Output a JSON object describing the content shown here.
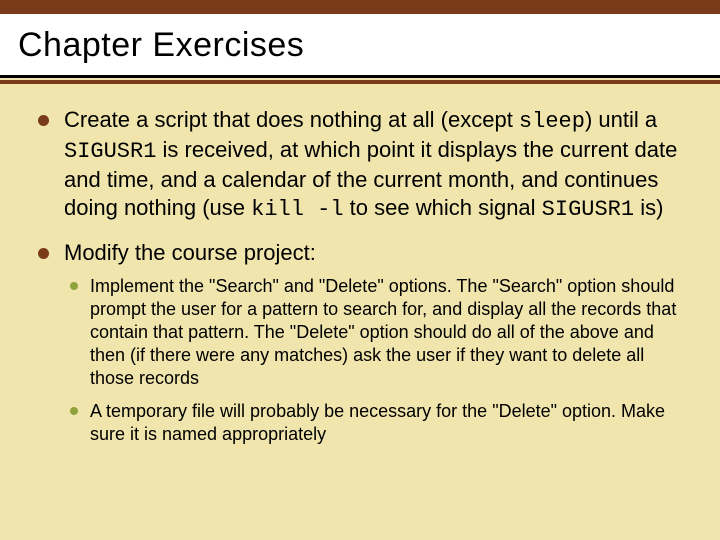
{
  "title": "Chapter Exercises",
  "bullets": {
    "item1": {
      "t1": "Create a script that does nothing at all (except ",
      "c1": "sleep",
      "t2": ") until a ",
      "c2": "SIGUSR1",
      "t3": " is received, at which point it displays the current date and time, and a calendar of the current month, and continues doing nothing (use ",
      "c3": "kill -l",
      "t4": " to see which signal ",
      "c4": "SIGUSR1",
      "t5": " is)"
    },
    "item2": {
      "t1": "Modify the course project:",
      "sub1": "Implement the \"Search\" and \"Delete\" options.  The \"Search\" option should prompt the user for a pattern to search for, and display all the records that contain that pattern.  The \"Delete\" option should do all of the above and then (if there were any matches) ask the user if they want to delete all those records",
      "sub2": "A temporary file will probably be necessary for the \"Delete\" option.  Make sure it is named appropriately"
    }
  }
}
